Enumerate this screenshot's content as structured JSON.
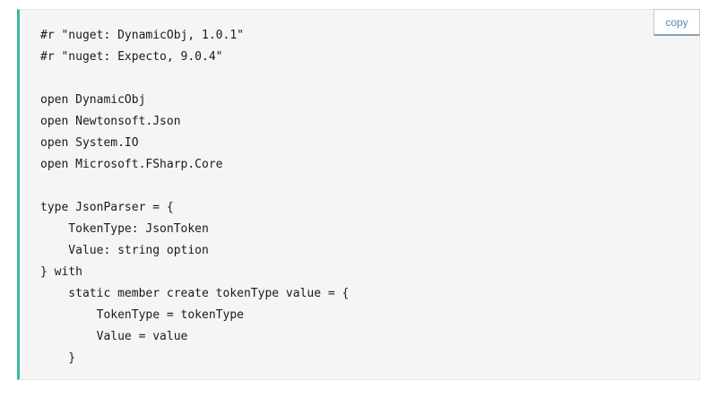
{
  "code_block": {
    "copy_label": "copy",
    "lines": [
      "#r \"nuget: DynamicObj, 1.0.1\"",
      "#r \"nuget: Expecto, 9.0.4\"",
      "",
      "open DynamicObj",
      "open Newtonsoft.Json",
      "open System.IO",
      "open Microsoft.FSharp.Core",
      "",
      "type JsonParser = {",
      "    TokenType: JsonToken",
      "    Value: string option",
      "} with",
      "    static member create tokenType value = {",
      "        TokenType = tokenType",
      "        Value = value",
      "    }"
    ],
    "accent_color": "#3bb9a0"
  }
}
